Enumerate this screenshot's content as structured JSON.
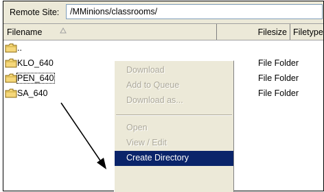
{
  "remote_site": {
    "label": "Remote Site:",
    "path": "/MMinions/classrooms/"
  },
  "columns": {
    "filename": "Filename",
    "filesize": "Filesize",
    "filetype": "Filetype"
  },
  "files": [
    {
      "name": "..",
      "type": ""
    },
    {
      "name": "KLO_640",
      "type": "File Folder"
    },
    {
      "name": "PEN_640",
      "type": "File Folder"
    },
    {
      "name": "SA_640",
      "type": "File Folder"
    }
  ],
  "context_menu": {
    "items": [
      {
        "label": "Download",
        "state": "disabled"
      },
      {
        "label": "Add to Queue",
        "state": "disabled"
      },
      {
        "label": "Download as...",
        "state": "disabled"
      },
      {
        "label": "Open",
        "state": "disabled"
      },
      {
        "label": "View / Edit",
        "state": "disabled"
      },
      {
        "label": "Create Directory",
        "state": "highlighted"
      }
    ]
  },
  "colors": {
    "highlight": "#0a246a",
    "folder": "#f5d77a",
    "disabled_text": "#aca899"
  }
}
